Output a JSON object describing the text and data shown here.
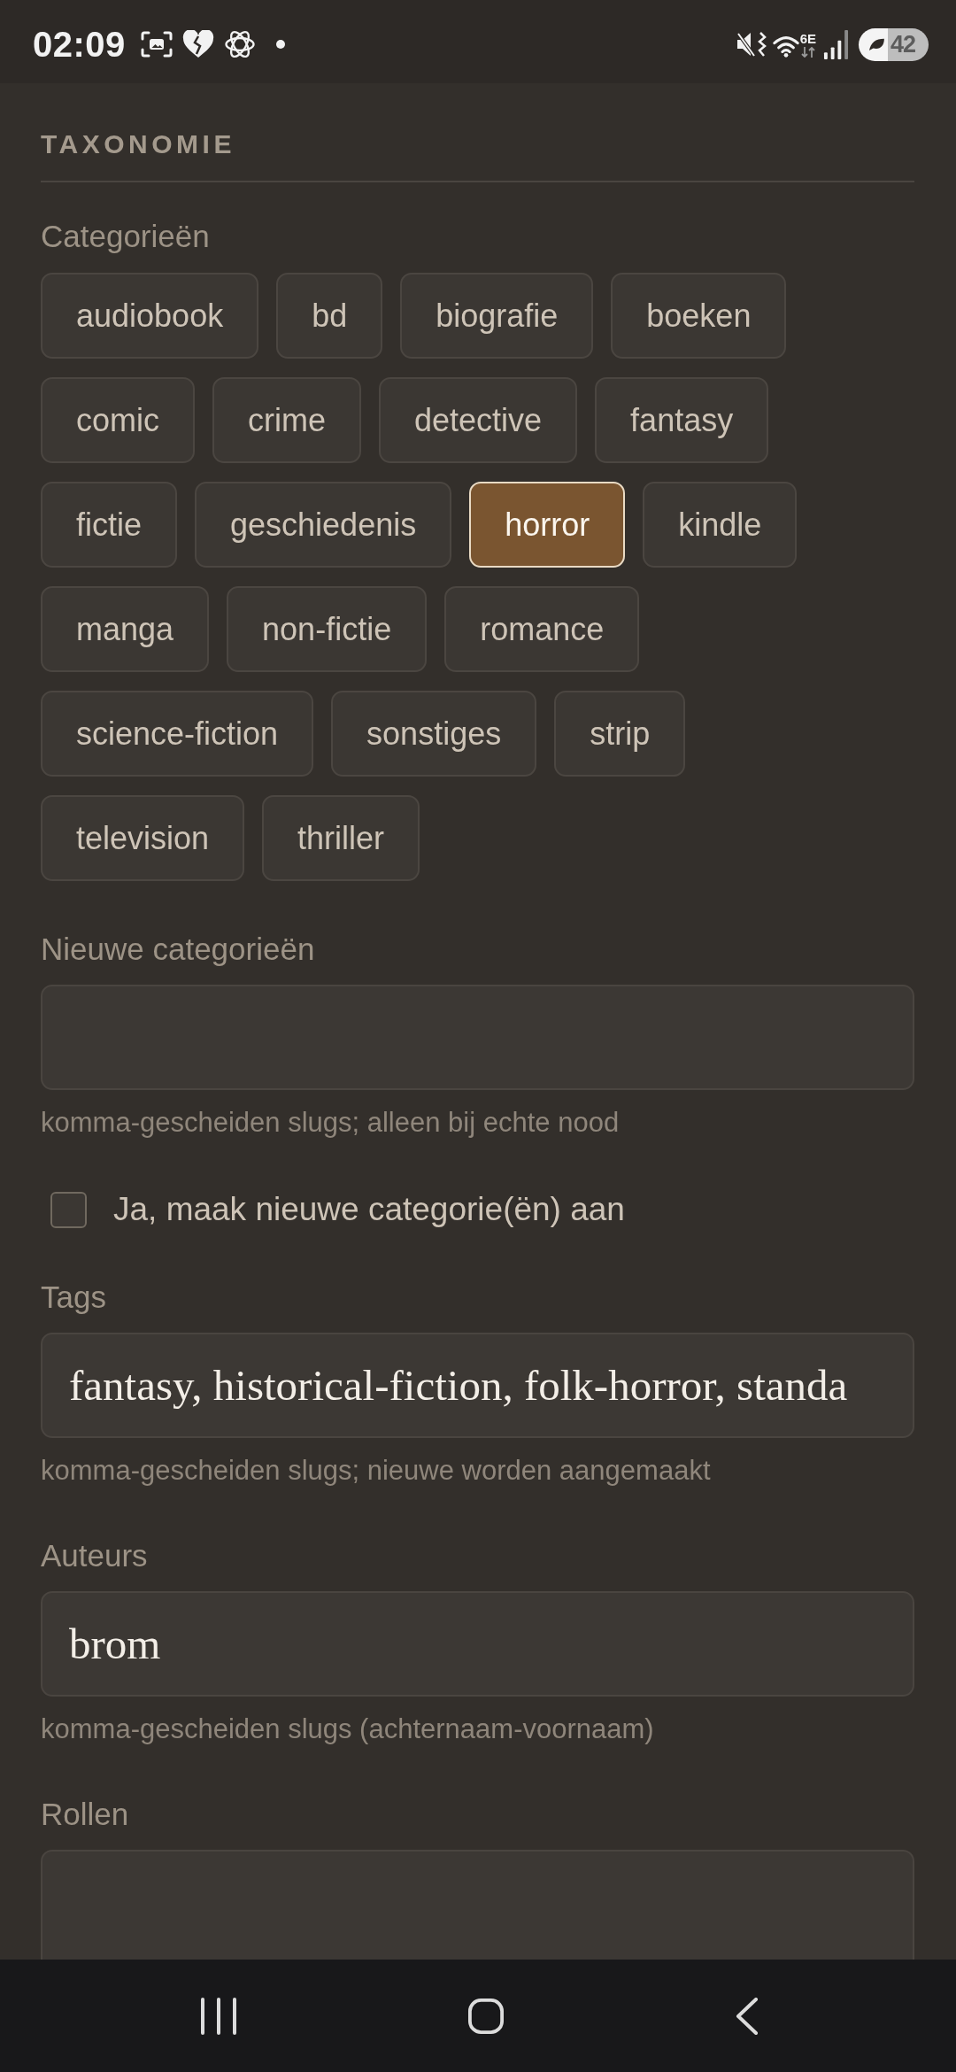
{
  "status_bar": {
    "time": "02:09",
    "network_type": "6E",
    "battery": "42"
  },
  "section": {
    "title": "TAXONOMIE"
  },
  "form": [
    {
      "kind": "chips",
      "label": "Categorieën",
      "items": [
        {
          "label": "audiobook",
          "selected": false
        },
        {
          "label": "bd",
          "selected": false
        },
        {
          "label": "biografie",
          "selected": false
        },
        {
          "label": "boeken",
          "selected": false
        },
        {
          "label": "comic",
          "selected": false
        },
        {
          "label": "crime",
          "selected": false
        },
        {
          "label": "detective",
          "selected": false
        },
        {
          "label": "fantasy",
          "selected": false
        },
        {
          "label": "fictie",
          "selected": false
        },
        {
          "label": "geschiedenis",
          "selected": false
        },
        {
          "label": "horror",
          "selected": true
        },
        {
          "label": "kindle",
          "selected": false
        },
        {
          "label": "manga",
          "selected": false
        },
        {
          "label": "non-fictie",
          "selected": false
        },
        {
          "label": "romance",
          "selected": false
        },
        {
          "label": "science-fiction",
          "selected": false
        },
        {
          "label": "sonstiges",
          "selected": false
        },
        {
          "label": "strip",
          "selected": false
        },
        {
          "label": "television",
          "selected": false
        },
        {
          "label": "thriller",
          "selected": false
        }
      ]
    },
    {
      "kind": "text",
      "label": "Nieuwe categorieën",
      "help": "komma-gescheiden slugs; alleen bij echte nood"
    },
    {
      "kind": "checkbox",
      "label": "Ja, maak nieuwe categorie(ën) aan",
      "checked": false
    },
    {
      "kind": "text",
      "label": "Tags",
      "value": "fantasy, historical-fiction, folk-horror, standa",
      "help": "komma-gescheiden slugs; nieuwe worden aangemaakt"
    },
    {
      "kind": "text",
      "label": "Auteurs",
      "value": "brom",
      "help": "komma-gescheiden slugs (achternaam-voornaam)"
    },
    {
      "kind": "text",
      "label": "Rollen"
    }
  ]
}
